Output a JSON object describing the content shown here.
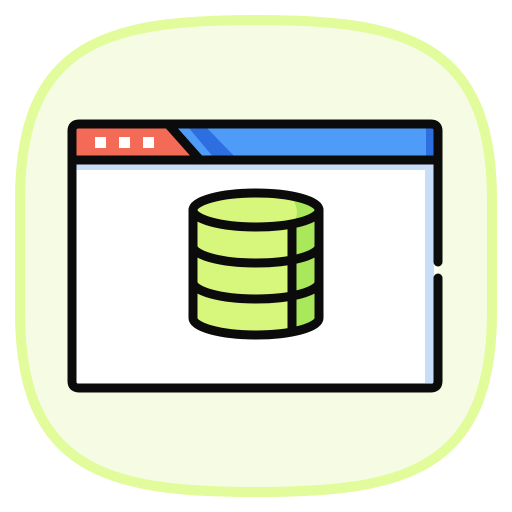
{
  "icon": {
    "semantic": "database-browser-window-icon",
    "colors": {
      "tile_fill": "#F5FCE3",
      "tile_stroke": "#E2FB9B",
      "outline": "#0B0B0B",
      "tab_red": "#F36B57",
      "title_bar_blue": "#4F9BF8",
      "title_bar_blue_dark": "#2D6FE0",
      "window_bg": "#FFFFFF",
      "window_shadow": "#C8DEF8",
      "db_fill": "#D7F77C",
      "db_shade": "#A9E85B",
      "dots": "#FFFFFF"
    }
  }
}
